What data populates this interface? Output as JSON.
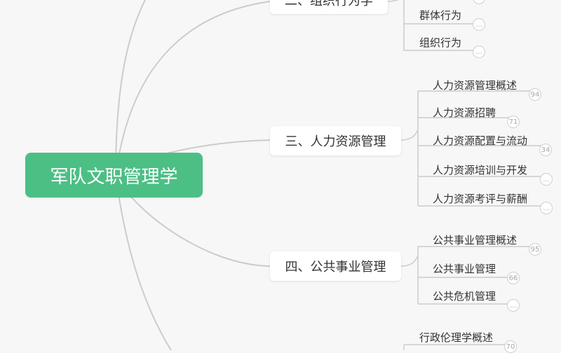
{
  "root": {
    "label": "军队文职管理学"
  },
  "branches": {
    "b2": {
      "label": "二、组织行为学",
      "leaves": [
        {
          "label": "群体行为",
          "badge": "..."
        },
        {
          "label": "组织行为",
          "badge": "..."
        }
      ],
      "top_badge": "..."
    },
    "b3": {
      "label": "三、人力资源管理",
      "leaves": [
        {
          "label": "人力资源管理概述",
          "badge": "94"
        },
        {
          "label": "人力资源招聘",
          "badge": "71"
        },
        {
          "label": "人力资源配置与流动",
          "badge": "34"
        },
        {
          "label": "人力资源培训与开发",
          "badge": "..."
        },
        {
          "label": "人力资源考评与薪酬",
          "badge": "..."
        }
      ]
    },
    "b4": {
      "label": "四、公共事业管理",
      "leaves": [
        {
          "label": "公共事业管理概述",
          "badge": "95"
        },
        {
          "label": "公共事业管理",
          "badge": "66"
        },
        {
          "label": "公共危机管理",
          "badge": "..."
        }
      ]
    },
    "b5": {
      "leaves": [
        {
          "label": "行政伦理学概述",
          "badge": "70"
        }
      ]
    }
  },
  "colors": {
    "root_bg": "#4cbf85",
    "connector": "#cccccc",
    "page_bg": "#f7f7f7"
  }
}
